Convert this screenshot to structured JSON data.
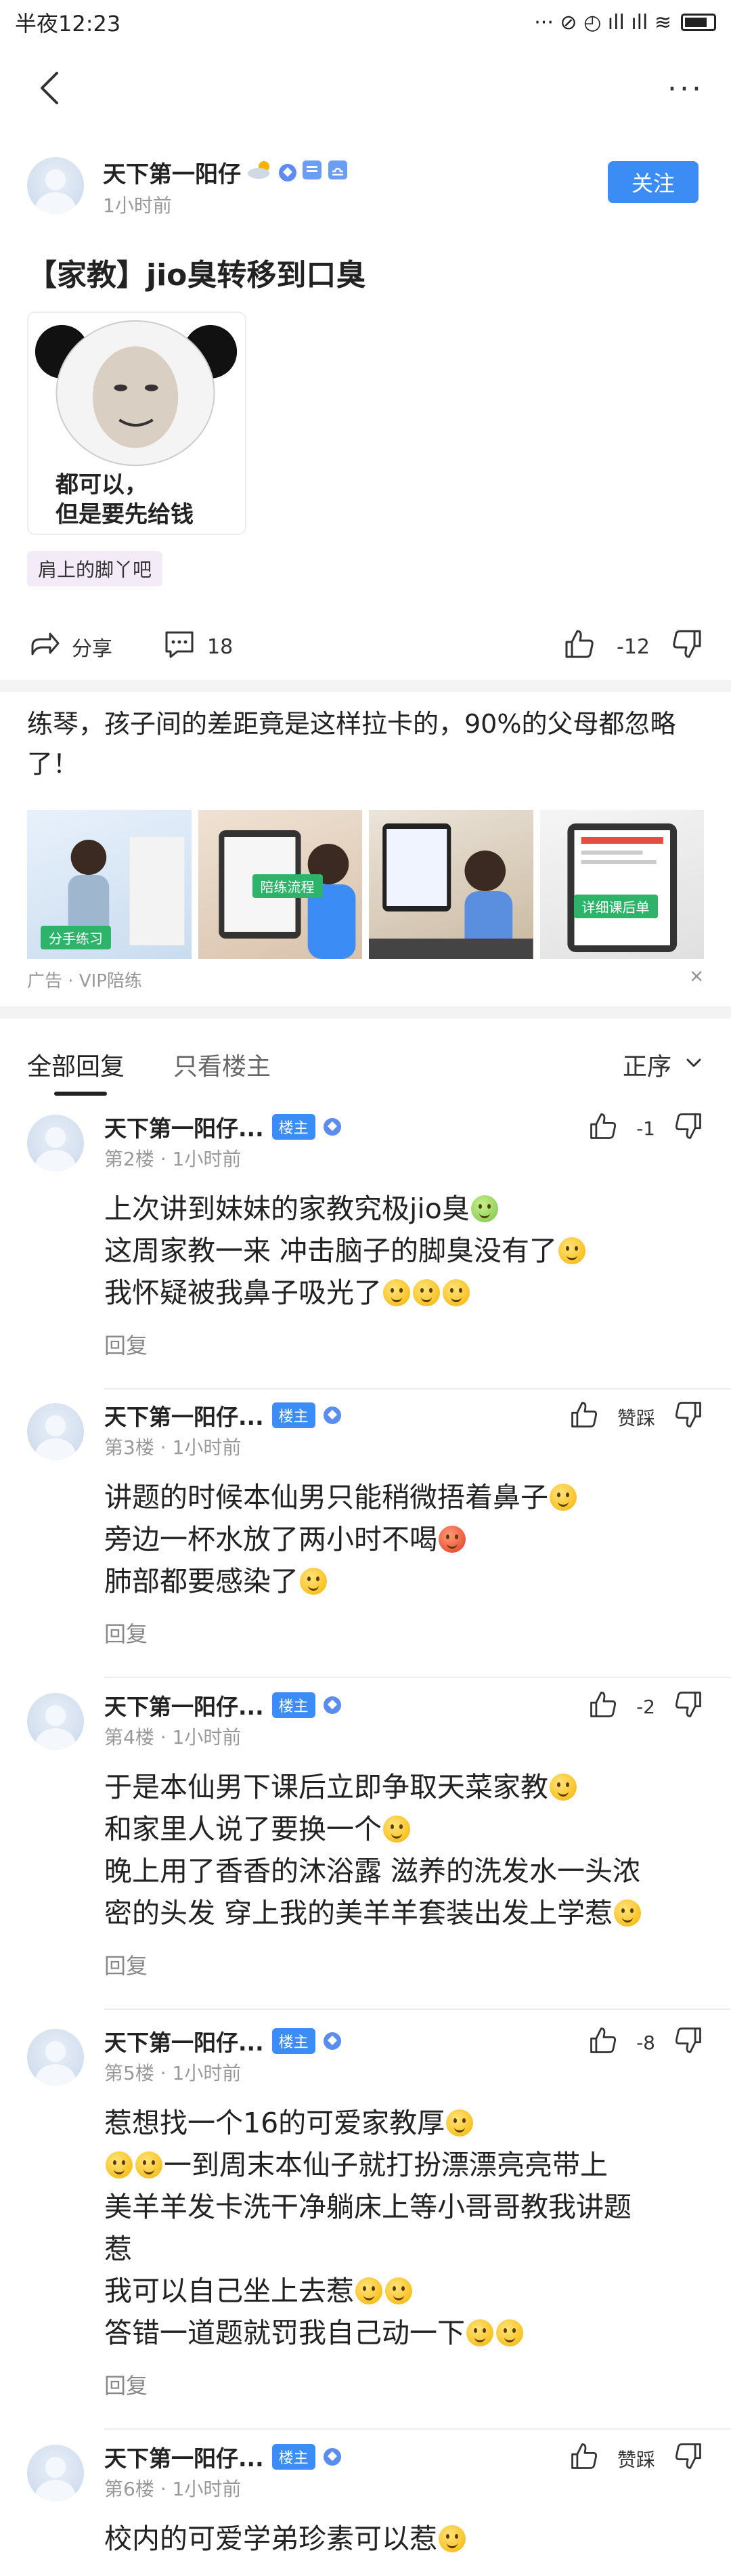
{
  "status_bar": {
    "time": "半夜12:23",
    "icons": "··· ⊘ ◴ ıll ıll ≋"
  },
  "nav": {
    "back_icon": "back-arrow-icon",
    "more_label": "···"
  },
  "post": {
    "author": "天下第一阳仔",
    "time": "1小时前",
    "follow_label": "关注",
    "title": "【家教】jio臭转移到口臭",
    "image_caption_line1": "都可以，",
    "image_caption_line2": "但是要先给钱",
    "forum": "肩上的脚丫吧",
    "share_label": "分享",
    "comment_count": "18",
    "vote_count": "-12"
  },
  "ad": {
    "title": "练琴，孩子间的差距竟是这样拉卡的，90%的父母都忽略了！",
    "tags": [
      "分手练习",
      "陪练流程",
      "",
      "详细课后单"
    ],
    "footer": "广告 · VIP陪练",
    "close_label": "✕"
  },
  "tabs": {
    "all": "全部回复",
    "host_only": "只看楼主",
    "sort": "正序"
  },
  "replies": [
    {
      "name": "天下第一阳仔...",
      "badge": "楼主",
      "meta": "第2楼 · 1小时前",
      "vote": "-1",
      "lines": [
        "上次讲到妹妹的家教究极jio臭",
        "这周家教一来 冲击脑子的脚臭没有了",
        "我怀疑被我鼻子吸光了"
      ],
      "reply_label": "回复"
    },
    {
      "name": "天下第一阳仔...",
      "badge": "楼主",
      "meta": "第3楼 · 1小时前",
      "vote": "赞踩",
      "lines": [
        "讲题的时候本仙男只能稍微捂着鼻子",
        "旁边一杯水放了两小时不喝",
        "肺部都要感染了"
      ],
      "reply_label": "回复"
    },
    {
      "name": "天下第一阳仔...",
      "badge": "楼主",
      "meta": "第4楼 · 1小时前",
      "vote": "-2",
      "lines": [
        "于是本仙男下课后立即争取天菜家教",
        "和家里人说了要换一个",
        "晚上用了香香的沐浴露 滋养的洗发水一头浓",
        "密的头发 穿上我的美羊羊套装出发上学惹"
      ],
      "reply_label": "回复"
    },
    {
      "name": "天下第一阳仔...",
      "badge": "楼主",
      "meta": "第5楼 · 1小时前",
      "vote": "-8",
      "lines": [
        "惹想找一个16的可爱家教厚",
        "一到周末本仙子就打扮漂漂亮亮带上",
        "美羊羊发卡洗干净躺床上等小哥哥教我讲题",
        "惹",
        "我可以自己坐上去惹",
        "答错一道题就罚我自己动一下"
      ],
      "reply_label": "回复"
    },
    {
      "name": "天下第一阳仔...",
      "badge": "楼主",
      "meta": "第6楼 · 1小时前",
      "vote": "赞踩",
      "lines": [
        "校内的可爱学弟珍素可以惹"
      ],
      "reply_label": ""
    }
  ]
}
